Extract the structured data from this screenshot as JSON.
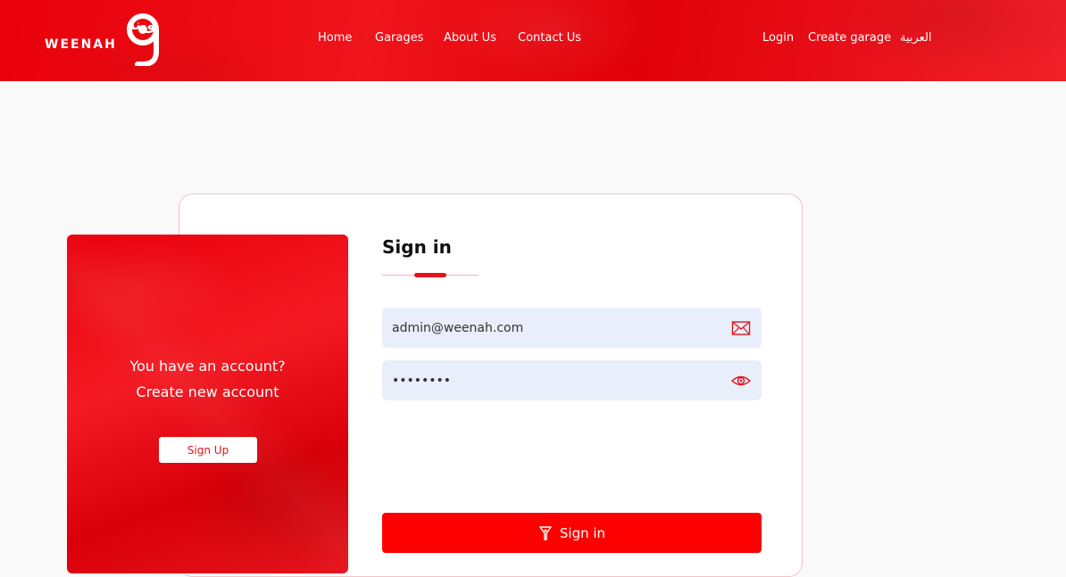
{
  "brand": {
    "arabic": "وينه",
    "english": "WEENAH"
  },
  "nav": {
    "home": "Home",
    "garages": "Garages",
    "about": "About Us",
    "contact": "Contact Us",
    "login": "Login",
    "create_garage": "Create garage",
    "language": "العربية"
  },
  "side_card": {
    "line1": "You have an account?",
    "line2": "Create new account",
    "signup_label": "Sign Up"
  },
  "form": {
    "title": "Sign in",
    "email_value": "admin@weenah.com",
    "password_value": "••••••••",
    "submit_label": "Sign in"
  },
  "icons": {
    "email": "envelope-icon",
    "password": "eye-icon",
    "submit": "sign-in-icon"
  },
  "colors": {
    "brand_red": "#e5141c",
    "button_red": "#ff0000",
    "field_bg": "#e8effb"
  }
}
